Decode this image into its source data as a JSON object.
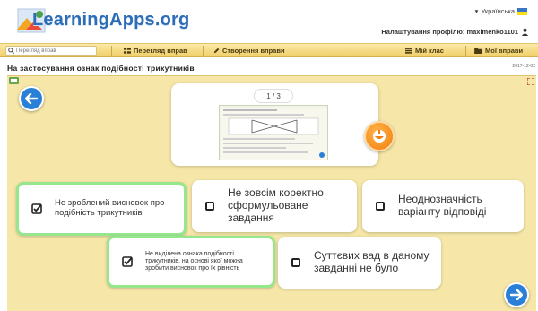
{
  "header": {
    "logo_text": "LearningApps.org",
    "language": "Українська",
    "profile": "Налаштування профілю: maximenko1101"
  },
  "nav": {
    "search_placeholder": "Перегляд вправ",
    "browse": "Перегляд вправ",
    "create": "Створення вправи",
    "my_class": "Мій клас",
    "my_apps": "Мої вправи"
  },
  "page": {
    "title": "На застосування ознак подібності трикутників",
    "date": "2017-12-02"
  },
  "card": {
    "page_indicator": "1 / 3"
  },
  "options": [
    {
      "text": "Не зроблений висновок про подібність трикутників",
      "selected": true
    },
    {
      "text": "Не зовсім коректно сформульоване завдання",
      "selected": false
    },
    {
      "text": "Неоднозначність варіанту відповіді",
      "selected": false
    },
    {
      "text": "Не виділена ознака подібності трикутників, на основі якої можна зробити висновок про їх рівність",
      "selected": true
    },
    {
      "text": "Суттєвих вад в даному завданні не було",
      "selected": false
    }
  ],
  "colors": {
    "accent_blue": "#2a7fd6",
    "app_background": "#f6e7a8",
    "nav_bar": "#f1cf6a",
    "selected_border": "#96e68e",
    "hint_orange": "#f07e10"
  },
  "icons": {
    "back": "arrow-left-icon",
    "next": "arrow-right-icon",
    "hint": "lightbulb-icon",
    "checked": "checked-box-icon",
    "unchecked": "empty-box-icon"
  }
}
